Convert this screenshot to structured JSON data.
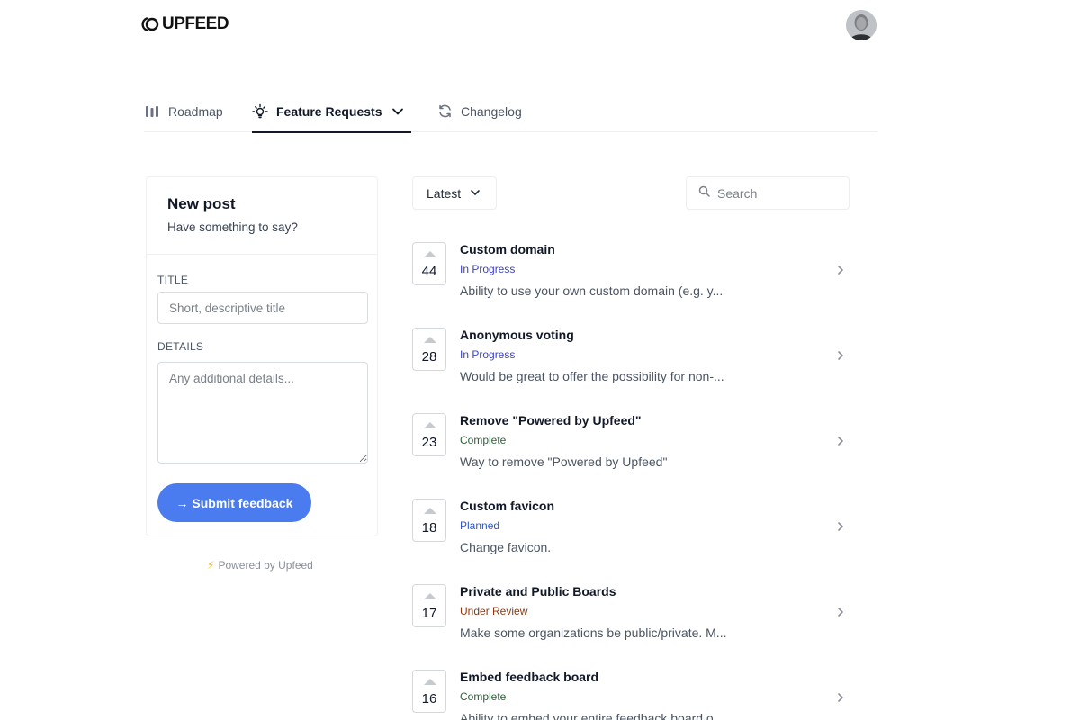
{
  "header": {
    "brand": "UPFEED"
  },
  "tabs": [
    {
      "label": "Roadmap",
      "icon": "roadmap-bars-icon"
    },
    {
      "label": "Feature Requests",
      "icon": "lightbulb-icon",
      "active": true
    },
    {
      "label": "Changelog",
      "icon": "refresh-icon"
    }
  ],
  "new_post": {
    "title": "New post",
    "subtitle": "Have something to say?",
    "title_label": "TITLE",
    "title_placeholder": "Short, descriptive title",
    "details_label": "DETAILS",
    "details_placeholder": "Any additional details...",
    "submit_label": "→ Submit feedback"
  },
  "powered_by": "Powered by Upfeed",
  "filters": {
    "sort_label": "Latest",
    "search_placeholder": "Search"
  },
  "status_colors": {
    "In Progress": "#3b3fc4",
    "Complete": "#2f5d3a",
    "Planned": "#2f55c8",
    "Under Review": "#8a3a12"
  },
  "posts": [
    {
      "votes": "44",
      "title": "Custom domain",
      "status": "In Progress",
      "desc": "Ability to use your own custom domain (e.g. y..."
    },
    {
      "votes": "28",
      "title": "Anonymous voting",
      "status": "In Progress",
      "desc": "Would be great to offer the possibility for non-..."
    },
    {
      "votes": "23",
      "title": "Remove \"Powered by Upfeed\"",
      "status": "Complete",
      "desc": "Way to remove \"Powered by Upfeed\""
    },
    {
      "votes": "18",
      "title": "Custom favicon",
      "status": "Planned",
      "desc": "Change favicon."
    },
    {
      "votes": "17",
      "title": "Private and Public Boards",
      "status": "Under Review",
      "desc": "Make some organizations be public/private. M..."
    },
    {
      "votes": "16",
      "title": "Embed feedback board",
      "status": "Complete",
      "desc": "Ability to embed your entire feedback board o..."
    }
  ]
}
